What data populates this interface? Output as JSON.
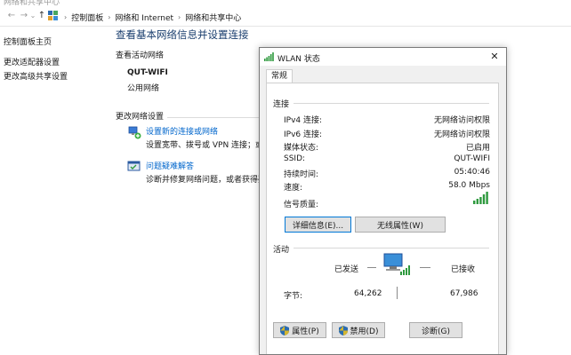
{
  "window": {
    "title_cut": "网络和共享中心"
  },
  "address_bar": {
    "crumbs": [
      "控制面板",
      "网络和 Internet",
      "网络和共享中心"
    ]
  },
  "sidebar": {
    "items": [
      {
        "label": "控制面板主页"
      },
      {
        "label": "更改适配器设置"
      },
      {
        "label": "更改高级共享设置"
      }
    ]
  },
  "main": {
    "title": "查看基本网络信息并设置连接",
    "active_networks_label": "查看活动网络",
    "network_name": "QUT-WIFI",
    "network_type": "公用网络",
    "change_settings_label": "更改网络设置",
    "tasks": [
      {
        "link": "设置新的连接或网络",
        "desc": "设置宽带、拨号或 VPN 连接；或设置"
      },
      {
        "link": "问题疑难解答",
        "desc": "诊断并修复网络问题，或者获得疑难解"
      }
    ]
  },
  "dialog": {
    "title": "WLAN 状态",
    "tab": "常规",
    "connection_group": "连接",
    "rows": [
      {
        "key": "IPv4 连接:",
        "value": "无网络访问权限"
      },
      {
        "key": "IPv6 连接:",
        "value": "无网络访问权限"
      },
      {
        "key": "媒体状态:",
        "value": "已启用"
      },
      {
        "key": "SSID:",
        "value": "QUT-WIFI"
      },
      {
        "key": "持续时间:",
        "value": "05:40:46"
      },
      {
        "key": "速度:",
        "value": "58.0 Mbps"
      }
    ],
    "signal_label": "信号质量:",
    "signal_bars": 5,
    "details_button": "详细信息(E)...",
    "wireless_props_button": "无线属性(W)",
    "activity_group": "活动",
    "sent_label": "已发送",
    "received_label": "已接收",
    "bytes_label": "字节:",
    "bytes_sent": "64,262",
    "bytes_received": "67,986",
    "properties_button": "属性(P)",
    "disable_button": "禁用(D)",
    "diagnose_button": "诊断(G)"
  },
  "colors": {
    "accent": "#0078d7",
    "link": "#0066cc",
    "title_blue": "#1a3e6e",
    "signal_green": "#2e9a3e"
  }
}
